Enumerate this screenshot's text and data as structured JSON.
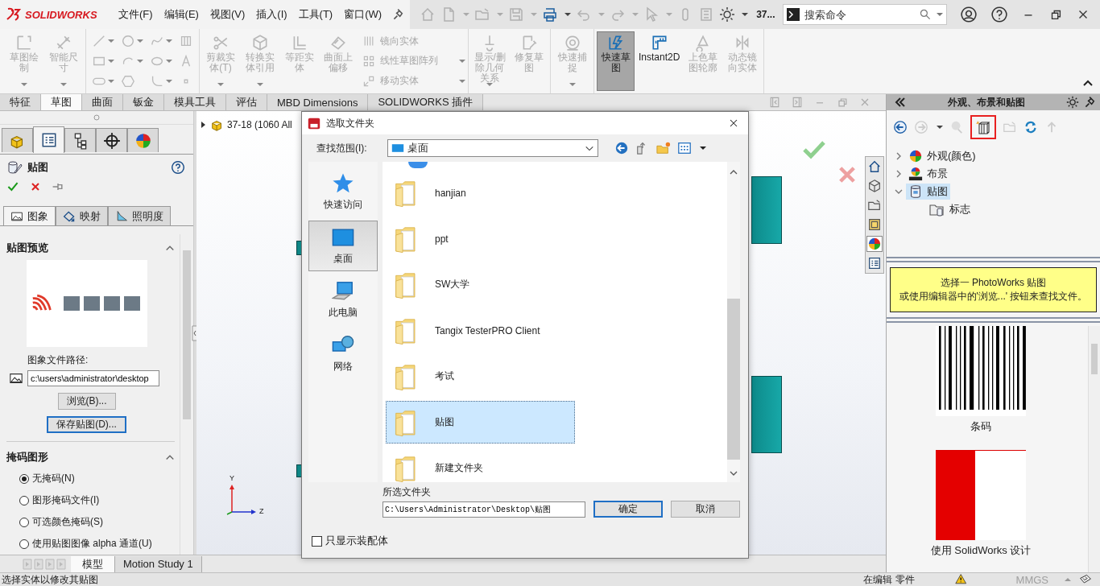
{
  "app": {
    "logo": "SOLIDWORKS",
    "menus": [
      "文件(F)",
      "编辑(E)",
      "视图(V)",
      "插入(I)",
      "工具(T)",
      "窗口(W)"
    ],
    "doc_name": "37...",
    "search": {
      "placeholder": "搜索命令"
    }
  },
  "ribbon": {
    "groups": [
      {
        "kind": "buttons",
        "buttons": [
          {
            "label": "草图绘制",
            "disabled": true,
            "selected": false,
            "dropdown": true
          },
          {
            "label": "智能尺寸",
            "disabled": true,
            "selected": false,
            "dropdown": true
          }
        ]
      },
      {
        "kind": "tool_grid"
      },
      {
        "kind": "buttons",
        "buttons": [
          {
            "label": "剪裁实体(T)",
            "disabled": true,
            "selected": false,
            "dropdown": true
          },
          {
            "label": "转换实体引用",
            "disabled": true,
            "selected": false,
            "dropdown": true
          },
          {
            "label": "等距实体",
            "disabled": true,
            "selected": false,
            "dropdown": false
          },
          {
            "label": "曲面上偏移",
            "disabled": true,
            "selected": false,
            "dropdown": false
          }
        ],
        "list": [
          {
            "label": "镜向实体",
            "disabled": true,
            "dropdown": false
          },
          {
            "label": "线性草图阵列",
            "disabled": true,
            "dropdown": true
          },
          {
            "label": "移动实体",
            "disabled": true,
            "dropdown": true
          }
        ]
      },
      {
        "kind": "buttons",
        "buttons": [
          {
            "label": "显示/删除几何关系",
            "disabled": true,
            "selected": false,
            "dropdown": true
          },
          {
            "label": "修复草图",
            "disabled": true,
            "selected": false,
            "dropdown": false
          }
        ]
      },
      {
        "kind": "buttons",
        "buttons": [
          {
            "label": "快速捕捉",
            "disabled": true,
            "selected": false,
            "dropdown": true
          }
        ]
      },
      {
        "kind": "buttons",
        "buttons": [
          {
            "label": "快速草图",
            "disabled": false,
            "selected": true,
            "dropdown": false
          },
          {
            "label": "Instant2D",
            "disabled": false,
            "selected": false,
            "dropdown": false
          },
          {
            "label": "上色草图轮廓",
            "disabled": true,
            "selected": false,
            "dropdown": false
          },
          {
            "label": "动态镜向实体",
            "disabled": true,
            "selected": false,
            "dropdown": false
          }
        ]
      }
    ]
  },
  "command_tabs": [
    {
      "label": "特征",
      "selected": false
    },
    {
      "label": "草图",
      "selected": true
    },
    {
      "label": "曲面",
      "selected": false
    },
    {
      "label": "钣金",
      "selected": false
    },
    {
      "label": "模具工具",
      "selected": false
    },
    {
      "label": "评估",
      "selected": false
    },
    {
      "label": "MBD Dimensions",
      "selected": false
    },
    {
      "label": "SOLIDWORKS 插件",
      "selected": false
    }
  ],
  "left_panel": {
    "tabs": [
      {
        "kind": "feature",
        "selected": false
      },
      {
        "kind": "property",
        "selected": true
      },
      {
        "kind": "config",
        "selected": false
      },
      {
        "kind": "target",
        "selected": false
      },
      {
        "kind": "display",
        "selected": false
      }
    ],
    "title": "贴图",
    "subtabs": [
      {
        "label": "图象",
        "kind": "image",
        "selected": true
      },
      {
        "label": "映射",
        "kind": "mapping",
        "selected": false
      },
      {
        "label": "照明度",
        "kind": "lighting",
        "selected": false
      }
    ],
    "preview_section": {
      "title": "贴图预览",
      "path_label": "图象文件路径:",
      "path_value": "c:\\users\\administrator\\desktop",
      "browse_button": "浏览(B)...",
      "save_button": "保存贴图(D)..."
    },
    "mask_section": {
      "title": "掩码图形",
      "options": [
        {
          "label": "无掩码(N)",
          "selected": true
        },
        {
          "label": "图形掩码文件(I)",
          "selected": false
        },
        {
          "label": "可选颜色掩码(S)",
          "selected": false
        },
        {
          "label": "使用贴图图像 alpha 通道(U)",
          "selected": false
        }
      ]
    }
  },
  "graphics": {
    "tree_item": "37-18 (1060 All",
    "axes": [
      "Y",
      "Z"
    ]
  },
  "model_tabs": [
    {
      "label": "模型",
      "selected": true
    },
    {
      "label": "Motion Study 1",
      "selected": false
    }
  ],
  "task_pane": {
    "title": "外观、布景和贴图",
    "tree": [
      {
        "label": "外观(颜色)",
        "kind": "appearance",
        "expanded": false,
        "selected": false
      },
      {
        "label": "布景",
        "kind": "scene",
        "expanded": false,
        "selected": false
      },
      {
        "label": "贴图",
        "kind": "decal",
        "expanded": true,
        "selected": true,
        "children": [
          {
            "label": "标志",
            "kind": "folder",
            "selected": false
          }
        ]
      }
    ],
    "hint": [
      "选择一 PhotoWorks 贴图",
      "或使用编辑器中的'浏览...' 按钮来查找文件。"
    ],
    "thumbnails": [
      {
        "label": "条码",
        "kind": "barcode"
      },
      {
        "label": "使用 SolidWorks 设计",
        "kind": "logo"
      }
    ]
  },
  "dialog": {
    "title": "选取文件夹",
    "look_in_label": "查找范围(I):",
    "look_in_value": "桌面",
    "places": [
      {
        "label": "快速访问",
        "kind": "quick",
        "selected": false
      },
      {
        "label": "桌面",
        "kind": "desktop",
        "selected": true
      },
      {
        "label": "此电脑",
        "kind": "pc",
        "selected": false
      },
      {
        "label": "网络",
        "kind": "network",
        "selected": false
      }
    ],
    "files": [
      {
        "name": "hanjian",
        "selected": false
      },
      {
        "name": "ppt",
        "selected": false
      },
      {
        "name": "SW大学",
        "selected": false
      },
      {
        "name": "Tangix TesterPRO Client",
        "selected": false
      },
      {
        "name": "考试",
        "selected": false
      },
      {
        "name": "贴图",
        "selected": true
      },
      {
        "name": "新建文件夹",
        "selected": false
      }
    ],
    "folder_label": "所选文件夹",
    "folder_value": "C:\\Users\\Administrator\\Desktop\\贴图",
    "ok": "确定",
    "cancel": "取消",
    "assembly_only": {
      "label": "只显示装配体",
      "checked": false
    }
  },
  "status_bar": {
    "message": "选择实体以修改其贴图",
    "mode": "在编辑 零件",
    "units": "MMGS"
  }
}
